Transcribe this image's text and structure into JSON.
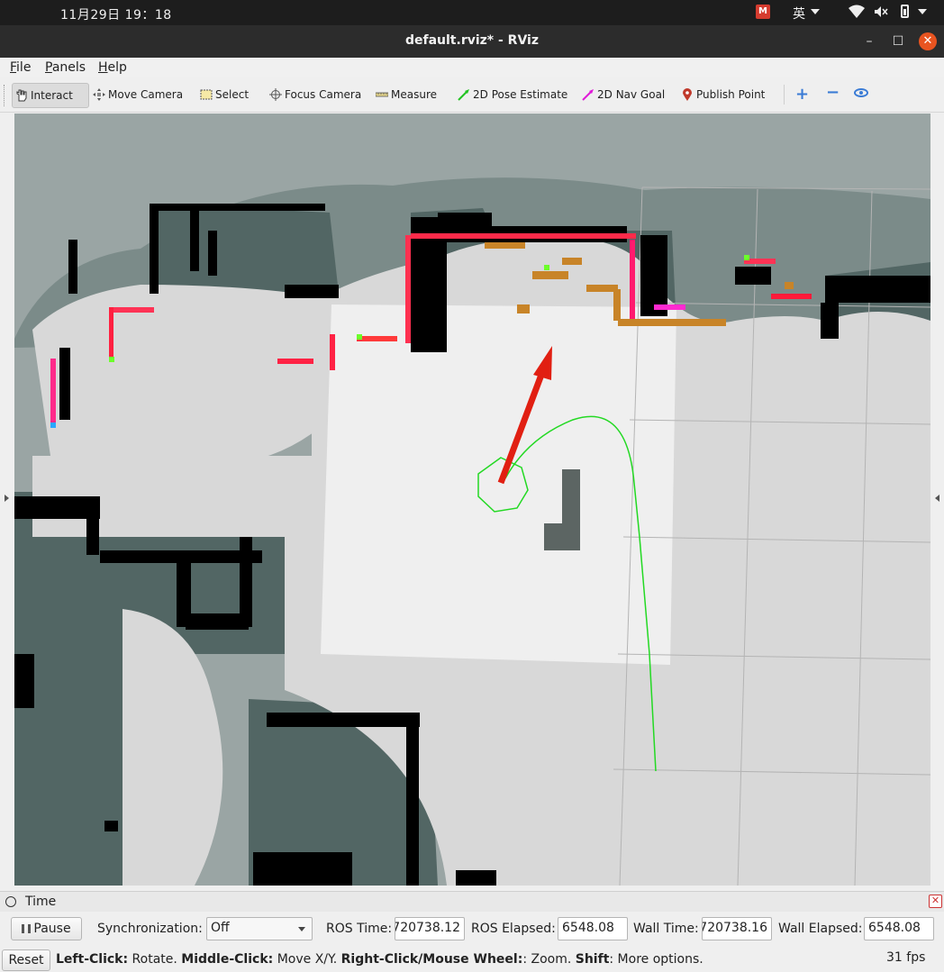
{
  "system": {
    "clock": "11月29日  19：18",
    "ime_logo": "M",
    "input_language": "英"
  },
  "window": {
    "title": "default.rviz* - RViz",
    "min": "–",
    "max": "☐",
    "close": "✕"
  },
  "menu": {
    "items": [
      {
        "mnemonic": "F",
        "rest": "ile"
      },
      {
        "mnemonic": "P",
        "rest": "anels"
      },
      {
        "mnemonic": "H",
        "rest": "elp"
      }
    ]
  },
  "toolbar": {
    "tools": [
      {
        "label": "Interact",
        "icon": "hand-icon",
        "active": true
      },
      {
        "label": "Move Camera",
        "icon": "move-camera-icon"
      },
      {
        "label": "Select",
        "icon": "select-box-icon"
      },
      {
        "label": "Focus Camera",
        "icon": "crosshair-icon"
      },
      {
        "label": "Measure",
        "icon": "ruler-icon"
      },
      {
        "label": "2D Pose Estimate",
        "icon": "green-arrow-icon"
      },
      {
        "label": "2D Nav Goal",
        "icon": "magenta-arrow-icon"
      },
      {
        "label": "Publish Point",
        "icon": "map-pin-icon"
      }
    ],
    "add": "+",
    "remove": "−"
  },
  "colors": {
    "occupied": "#000000",
    "unknown": "#9aa5a4",
    "free": "#dadada",
    "inflated": "#526664",
    "pose_arrow": "#e11f12",
    "path": "#23d923",
    "footprint": "#23d923",
    "obstacle_points": "#c88428"
  },
  "time_panel": {
    "title": "Time",
    "pause_label": "Pause",
    "sync_label": "Synchronization:",
    "sync_value": "Off",
    "ros_time_label": "ROS Time:",
    "ros_time": "720738.12",
    "ros_elapsed_label": "ROS Elapsed:",
    "ros_elapsed": "6548.08",
    "wall_time_label": "Wall Time:",
    "wall_time": "720738.16",
    "wall_elapsed_label": "Wall Elapsed:",
    "wall_elapsed": "6548.08"
  },
  "status": {
    "reset_label": "Reset",
    "hint_parts": [
      {
        "b": "Left-Click:",
        "t": " Rotate. "
      },
      {
        "b": "Middle-Click:",
        "t": " Move X/Y. "
      },
      {
        "b": "Right-Click/Mouse Wheel:",
        "t": ": Zoom. "
      },
      {
        "b": "Shift",
        "t": ": More options."
      }
    ],
    "fps": "31 fps"
  }
}
